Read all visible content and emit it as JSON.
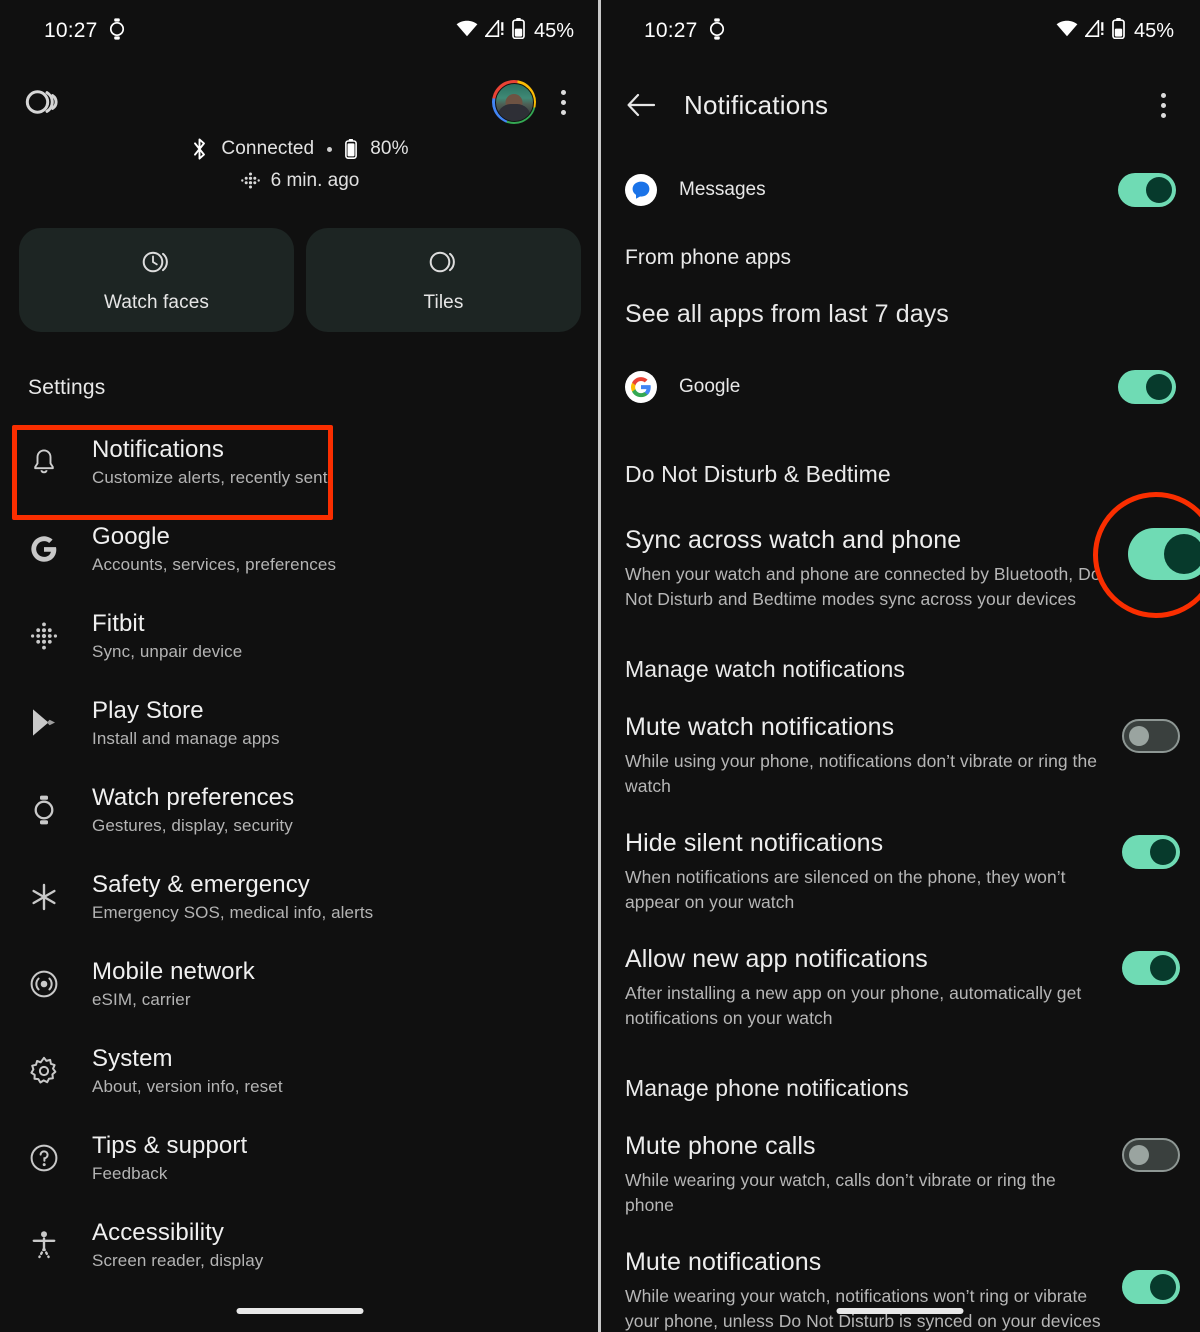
{
  "left": {
    "status_bar": {
      "time": "10:27",
      "watch_icon": "watch-icon",
      "wifi_icon": "wifi-icon",
      "signal_icon": "cellular-alert-icon",
      "battery_icon": "battery-icon",
      "battery_text": "45%"
    },
    "header": {
      "logo": "wear-os-logo",
      "avatar": "user-avatar",
      "overflow": "more-options-icon"
    },
    "connection": {
      "bluetooth_icon": "bluetooth-icon",
      "status": "Connected",
      "separator": "•",
      "battery_icon": "battery-icon",
      "battery": "80%",
      "sync_icon": "fitbit-icon",
      "last_sync": "6 min. ago"
    },
    "cards": [
      {
        "label": "Watch faces",
        "icon": "watch-face-icon"
      },
      {
        "label": "Tiles",
        "icon": "tiles-icon"
      }
    ],
    "settings_header": "Settings",
    "settings": [
      {
        "icon": "bell-icon",
        "title": "Notifications",
        "subtitle": "Customize alerts, recently sent",
        "highlighted": true
      },
      {
        "icon": "google-g-icon",
        "title": "Google",
        "subtitle": "Accounts, services, preferences"
      },
      {
        "icon": "fitbit-icon",
        "title": "Fitbit",
        "subtitle": "Sync, unpair device"
      },
      {
        "icon": "play-store-icon",
        "title": "Play Store",
        "subtitle": "Install and manage apps"
      },
      {
        "icon": "watch-icon",
        "title": "Watch preferences",
        "subtitle": "Gestures, display, security"
      },
      {
        "icon": "medical-star-icon",
        "title": "Safety & emergency",
        "subtitle": "Emergency SOS, medical info, alerts"
      },
      {
        "icon": "cell-tower-icon",
        "title": "Mobile network",
        "subtitle": "eSIM, carrier"
      },
      {
        "icon": "gear-icon",
        "title": "System",
        "subtitle": "About, version info, reset"
      },
      {
        "icon": "question-mark-icon",
        "title": "Tips & support",
        "subtitle": "Feedback"
      },
      {
        "icon": "accessibility-icon",
        "title": "Accessibility",
        "subtitle": "Screen reader, display"
      }
    ]
  },
  "right": {
    "status_bar": {
      "time": "10:27",
      "watch_icon": "watch-icon",
      "battery_text": "45%"
    },
    "appbar": {
      "back": "back-arrow-icon",
      "title": "Notifications",
      "overflow": "more-options-icon"
    },
    "messages_app": {
      "name": "Messages",
      "icon": "messages-icon",
      "toggle": "on"
    },
    "from_phone_apps_header": "From phone apps",
    "see_all_apps_link": "See all apps from last 7 days",
    "google_app": {
      "name": "Google",
      "icon": "google-g-icon",
      "toggle": "on"
    },
    "dnd_header": "Do Not Disturb & Bedtime",
    "sync_pref": {
      "title": "Sync across watch and phone",
      "desc": "When your watch and phone are connected by Bluetooth, Do Not Disturb and Bedtime modes sync across your devices",
      "toggle": "on",
      "annotated": true
    },
    "manage_watch_header": "Manage watch notifications",
    "watch_prefs": [
      {
        "title": "Mute watch notifications",
        "desc": "While using your phone, notifications don’t vibrate or ring the watch",
        "toggle": "off"
      },
      {
        "title": "Hide silent notifications",
        "desc": "When notifications are silenced on the phone, they won’t appear on your watch",
        "toggle": "on"
      },
      {
        "title": "Allow new app notifications",
        "desc": "After installing a new app on your phone, automatically get notifications on your watch",
        "toggle": "on"
      }
    ],
    "manage_phone_header": "Manage phone notifications",
    "phone_prefs": [
      {
        "title": "Mute phone calls",
        "desc": "While wearing your watch, calls don’t vibrate or ring the phone",
        "toggle": "off"
      },
      {
        "title": "Mute notifications",
        "desc": "While wearing your watch, notifications won’t ring or vibrate your phone, unless Do Not Disturb is synced on your devices",
        "toggle": "on"
      }
    ]
  },
  "annotation": {
    "color": "#fa2e00",
    "highlight_target": "Notifications",
    "circle_target": "Sync across watch and phone toggle"
  },
  "theme": {
    "background": "#101010",
    "card": "#1d2523",
    "toggle_on": "#6fdbb4",
    "toggle_on_thumb": "#073a2c",
    "toggle_off_track": "#3a403e",
    "text_primary": "#ededed",
    "text_secondary": "#b4b4b4"
  }
}
